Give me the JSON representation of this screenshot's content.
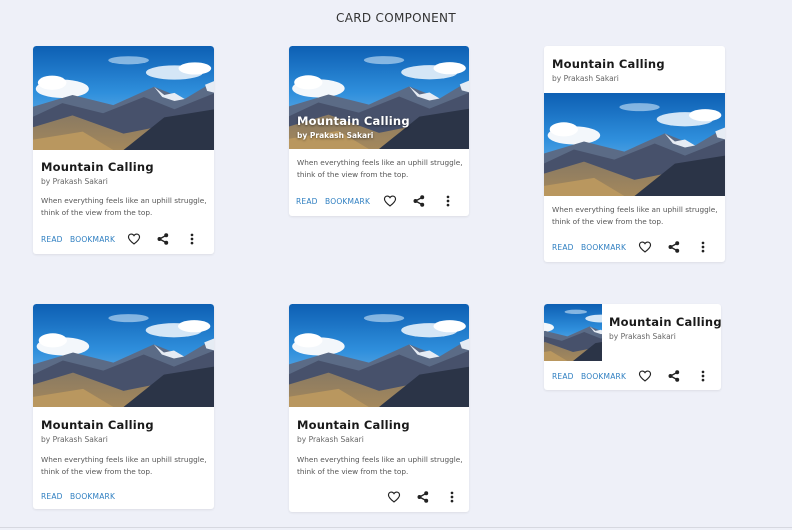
{
  "page": {
    "title": "CARD COMPONENT"
  },
  "card": {
    "title": "Mountain Calling",
    "author": "by Prakash Sakari",
    "description_line1": "When everything feels like an uphill struggle,",
    "description_line2": "think of the view from the top.",
    "read_label": "READ",
    "bookmark_label": "BOOKMARK"
  },
  "icons": [
    "heart-icon",
    "share-icon",
    "more-vertical-icon"
  ],
  "colors": {
    "background": "#eef0f8",
    "accent": "#2f7fc1",
    "card": "#ffffff"
  }
}
